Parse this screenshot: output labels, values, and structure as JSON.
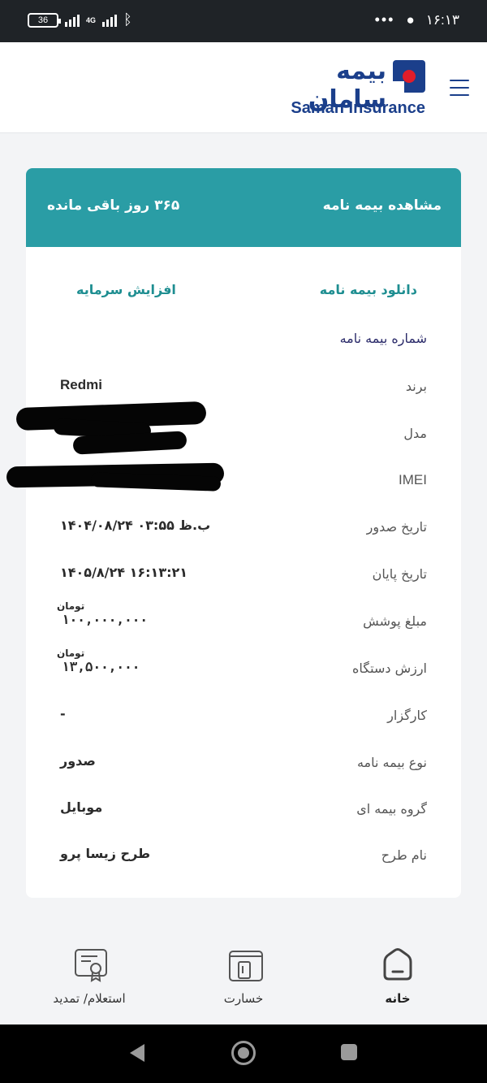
{
  "status_bar": {
    "battery": "36",
    "network": "4G",
    "time": "۱۶:۱۳",
    "more": "•••"
  },
  "header": {
    "logo_fa": "بیمه سامان",
    "logo_en": "Saman Insurance"
  },
  "card": {
    "title": "مشاهده بیمه نامه",
    "remaining": "۳۶۵ روز باقی مانده",
    "actions": {
      "download": "دانلود بیمه نامه",
      "invest": "افزایش سرمایه"
    },
    "policy_number_label": "شماره بیمه نامه",
    "currency_unit": "تومان",
    "rows": [
      {
        "label": "برند",
        "value": "Redmi"
      },
      {
        "label": "مدل",
        "value": ""
      },
      {
        "label": "IMEI",
        "value": ""
      },
      {
        "label": "تاریخ صدور",
        "value": "۱۴۰۴/۰۸/۲۴  ۰۳:۵۵ ب.ظ"
      },
      {
        "label": "تاریخ پایان",
        "value": "۱۴۰۵/۸/۲۴  ۱۶:۱۳:۲۱"
      },
      {
        "label": "مبلغ پوشش",
        "value": "۱۰۰,۰۰۰,۰۰۰"
      },
      {
        "label": "ارزش دستگاه",
        "value": "۱۳,۵۰۰,۰۰۰"
      },
      {
        "label": "کارگزار",
        "value": "-"
      },
      {
        "label": "نوع بیمه نامه",
        "value": "صدور"
      },
      {
        "label": "گروه بیمه ای",
        "value": "موبایل"
      },
      {
        "label": "نام طرح",
        "value": "طرح زیسا پرو"
      }
    ]
  },
  "bottom_nav": {
    "home": "خانه",
    "claim": "خسارت",
    "inquiry": "استعلام/ تمدید"
  }
}
